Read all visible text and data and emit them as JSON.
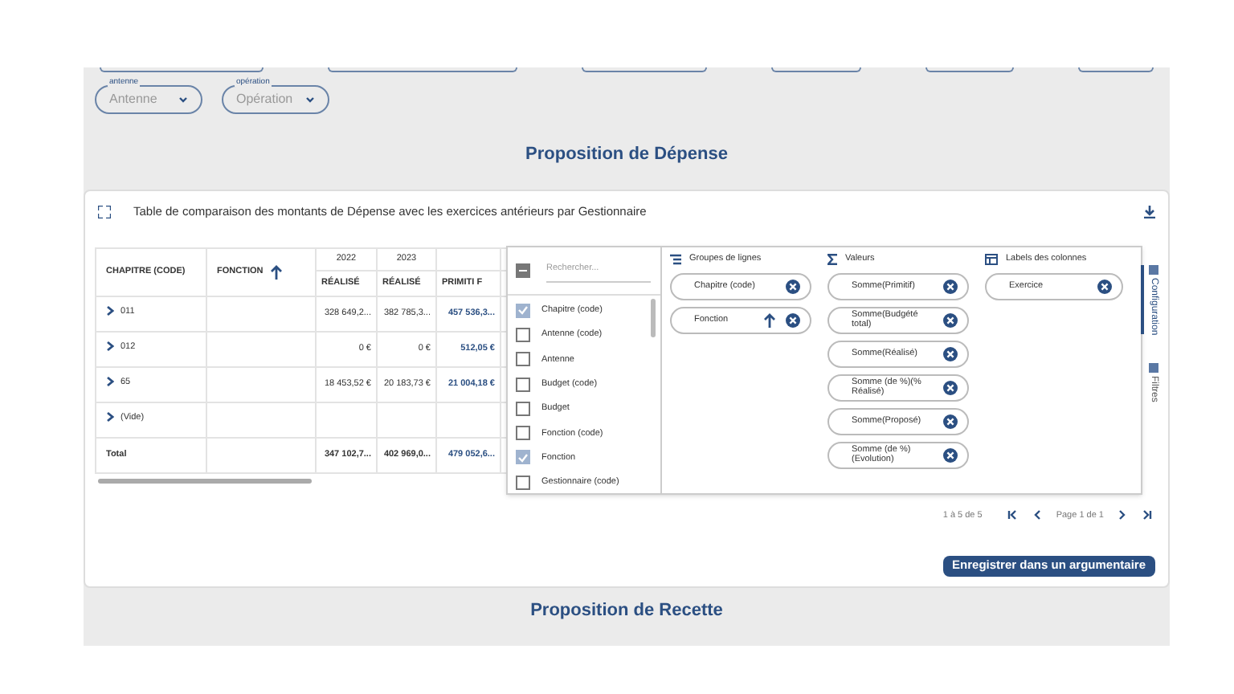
{
  "filters": [
    {
      "label": "antenne",
      "value": "Antenne"
    },
    {
      "label": "opération",
      "value": "Opération"
    }
  ],
  "section_title": "Proposition de Dépense",
  "card": {
    "title": "Table de comparaison des montants de Dépense avec les exercices antérieurs par Gestionnaire",
    "table": {
      "columns": [
        {
          "label": "CHAPITRE (CODE)",
          "sorted": false
        },
        {
          "label": "FONCTION",
          "sorted": true
        }
      ],
      "years": [
        "2022",
        "2023"
      ],
      "value_columns": [
        "RÉALISÉ",
        "RÉALISÉ",
        "PRIMITI F"
      ],
      "rows": [
        {
          "label": "011",
          "expandable": true,
          "cells": [
            "328 649,2...",
            "382 785,3...",
            "457 536,3..."
          ]
        },
        {
          "label": "012",
          "expandable": true,
          "cells": [
            "0 €",
            "0 €",
            "512,05 €"
          ]
        },
        {
          "label": "65",
          "expandable": true,
          "cells": [
            "18 453,52 €",
            "20 183,73 €",
            "21 004,18 €"
          ]
        },
        {
          "label": "(Vide)",
          "expandable": true,
          "cells": [
            "",
            "",
            ""
          ]
        },
        {
          "label": "Total",
          "expandable": false,
          "cells": [
            "347 102,7...",
            "402 969,0...",
            "479 052,6..."
          ]
        }
      ]
    },
    "config": {
      "select_all_indeterminate": true,
      "search": {
        "placeholder": "Rechercher..."
      },
      "fields": [
        {
          "label": "Chapitre (code)",
          "checked": true
        },
        {
          "label": "Antenne (code)",
          "checked": false
        },
        {
          "label": "Antenne",
          "checked": false
        },
        {
          "label": "Budget (code)",
          "checked": false
        },
        {
          "label": "Budget",
          "checked": false
        },
        {
          "label": "Fonction (code)",
          "checked": false
        },
        {
          "label": "Fonction",
          "checked": true
        },
        {
          "label": "Gestionnaire (code)",
          "checked": false
        }
      ],
      "row_groups": {
        "title": "Groupes de lignes",
        "items": [
          {
            "label": "Chapitre (code)",
            "sorted": false
          },
          {
            "label": "Fonction",
            "sorted": true
          }
        ]
      },
      "values": {
        "title": "Valeurs",
        "items": [
          "Somme(Primitif)",
          "Somme(Budgété total)",
          "Somme(Réalisé)",
          "Somme (de %)(% Réalisé)",
          "Somme(Proposé)",
          "Somme (de %) (Evolution)"
        ]
      },
      "column_labels": {
        "title": "Labels des colonnes",
        "items": [
          "Exercice"
        ]
      }
    },
    "side_tabs": [
      {
        "label": "Configuration",
        "selected": true
      },
      {
        "label": "Filtres",
        "selected": false
      }
    ],
    "pagination": {
      "range": "1 à 5 de 5",
      "page": "Page 1 de 1"
    },
    "save_button": "Enregistrer dans un argumentaire"
  },
  "next_section_title": "Proposition de Recette"
}
